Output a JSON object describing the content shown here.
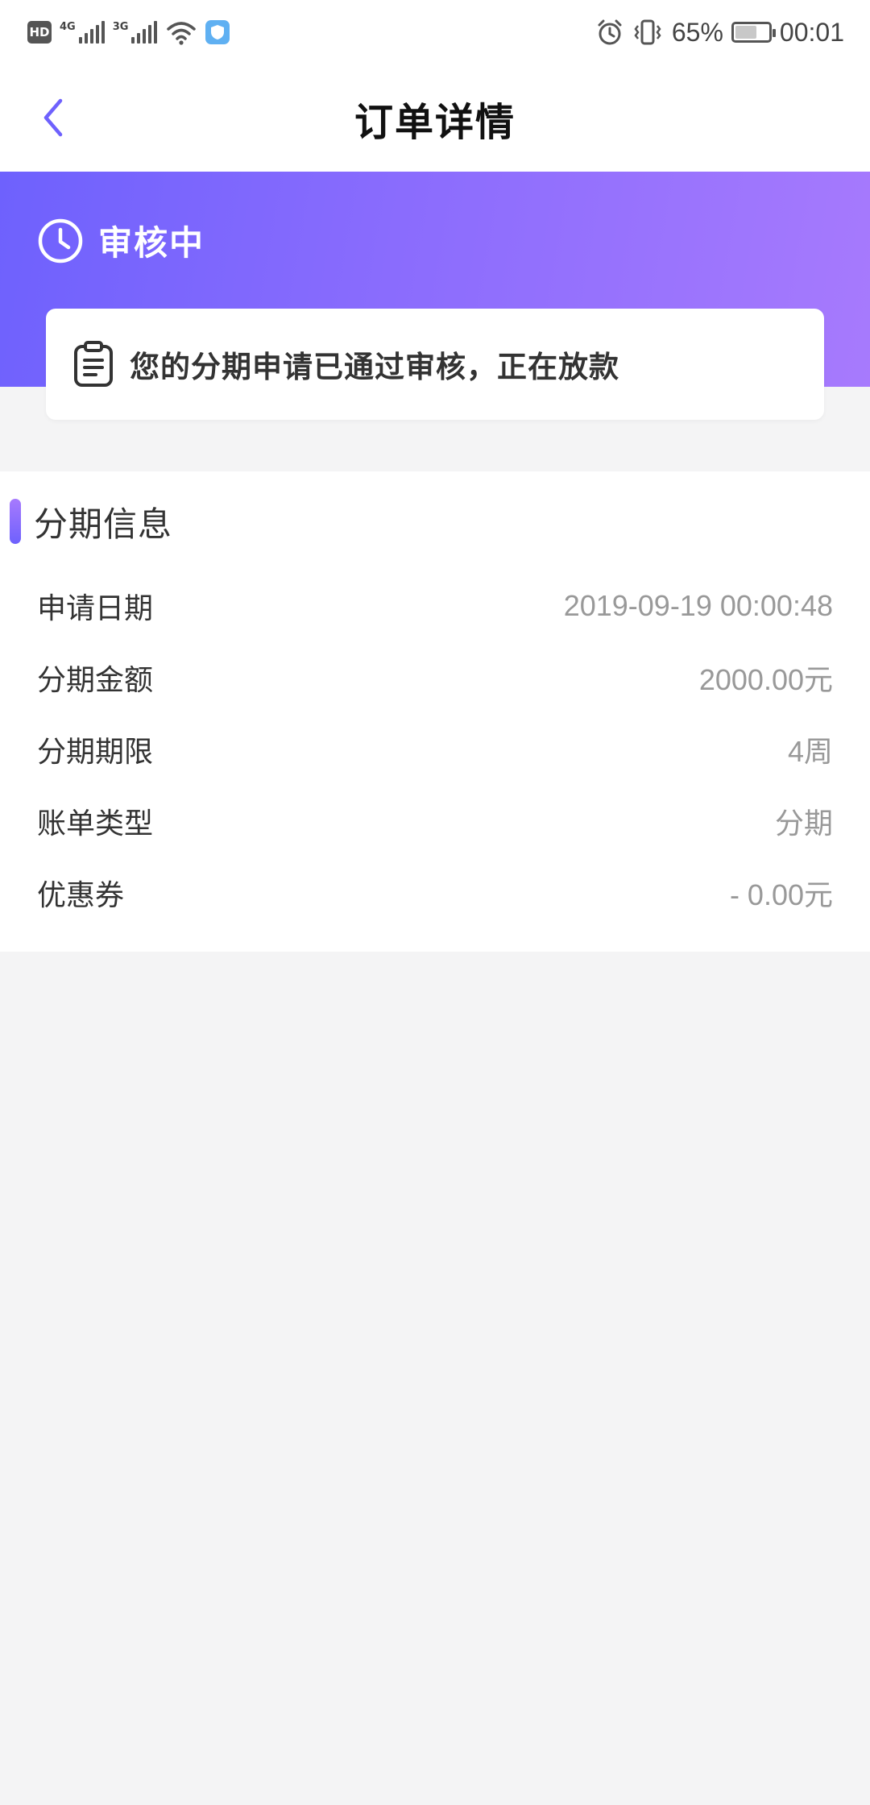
{
  "status_bar": {
    "hd_badge": "HD",
    "network_1": "4G",
    "network_2": "3G",
    "battery_percent": "65%",
    "time": "00:01",
    "battery_level": 0.65
  },
  "nav": {
    "title": "订单详情",
    "back_icon": "chevron-left-icon"
  },
  "status": {
    "icon": "clock-icon",
    "label": "审核中"
  },
  "notice": {
    "icon": "clipboard-icon",
    "text": "您的分期申请已通过审核，正在放款"
  },
  "info": {
    "title": "分期信息",
    "rows": [
      {
        "label": "申请日期",
        "value": "2019-09-19 00:00:48"
      },
      {
        "label": "分期金额",
        "value": "2000.00元"
      },
      {
        "label": "分期期限",
        "value": "4周"
      },
      {
        "label": "账单类型",
        "value": "分期"
      },
      {
        "label": "优惠券",
        "value": "- 0.00元"
      }
    ]
  },
  "colors": {
    "gradient_start": "#6e61fd",
    "gradient_end": "#a77afd",
    "value_gray": "#999999",
    "background": "#f4f4f5"
  }
}
